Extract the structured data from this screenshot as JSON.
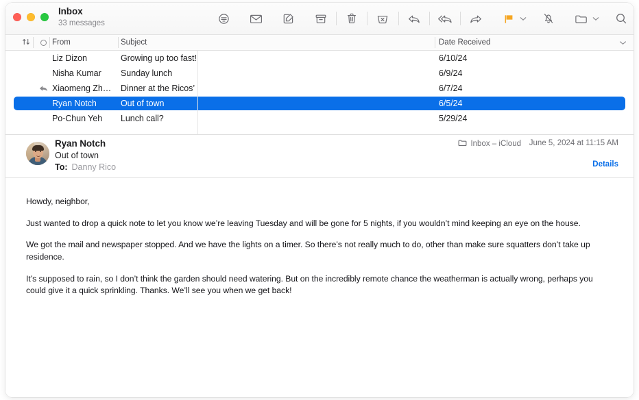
{
  "window": {
    "title": "Inbox",
    "subtitle": "33 messages",
    "traffic_lights": [
      "close",
      "minimize",
      "zoom"
    ]
  },
  "toolbar": {
    "items": [
      {
        "name": "filter-button",
        "icon": "filter-icon",
        "label": "Filter"
      },
      {
        "name": "mark-read-button",
        "icon": "envelope-icon",
        "label": "Mark as Read"
      },
      {
        "name": "compose-button",
        "icon": "compose-icon",
        "label": "New Message"
      },
      {
        "name": "archive-button",
        "icon": "archive-box-icon",
        "label": "Archive"
      },
      {
        "name": "delete-button",
        "icon": "trash-icon",
        "label": "Delete"
      },
      {
        "name": "junk-button",
        "icon": "junk-icon",
        "label": "Move to Junk"
      },
      {
        "name": "reply-button",
        "icon": "reply-arrow-icon",
        "label": "Reply"
      },
      {
        "name": "reply-all-button",
        "icon": "reply-all-icon",
        "label": "Reply All"
      },
      {
        "name": "forward-button",
        "icon": "forward-arrow-icon",
        "label": "Forward"
      },
      {
        "name": "flag-button",
        "icon": "flag-icon",
        "label": "Flag"
      },
      {
        "name": "mute-button",
        "icon": "bell-slash-icon",
        "label": "Mute"
      },
      {
        "name": "move-button",
        "icon": "folder-icon",
        "label": "Move To"
      },
      {
        "name": "search-button",
        "icon": "search-icon",
        "label": "Search"
      }
    ],
    "flag_color": "#f5a623"
  },
  "columns": {
    "sort": "sort-arrows-icon",
    "unread": "unread-circle-icon",
    "from": "From",
    "subject": "Subject",
    "date": "Date Received",
    "sort_chevron": "chevron-down-icon"
  },
  "messages": [
    {
      "flag": "",
      "from": "Liz Dizon",
      "subject": "Growing up too fast!",
      "date": "6/10/24",
      "selected": false
    },
    {
      "flag": "",
      "from": "Nisha Kumar",
      "subject": "Sunday lunch",
      "date": "6/9/24",
      "selected": false
    },
    {
      "flag": "replied",
      "from": "Xiaomeng Zh…",
      "subject": "Dinner at the Ricos’",
      "date": "6/7/24",
      "selected": false
    },
    {
      "flag": "",
      "from": "Ryan Notch",
      "subject": "Out of town",
      "date": "6/5/24",
      "selected": true
    },
    {
      "flag": "",
      "from": "Po-Chun Yeh",
      "subject": "Lunch call?",
      "date": "5/29/24",
      "selected": false
    }
  ],
  "selection_color": "#0a6fe8",
  "message": {
    "sender": "Ryan Notch",
    "subject": "Out of town",
    "to_label": "To:",
    "to_value": "Danny Rico",
    "mailbox": "Inbox – iCloud",
    "mailbox_icon": "folder-icon",
    "date": "June 5, 2024 at 11:15 AM",
    "details_link": "Details",
    "avatar": "contact-photo",
    "body": [
      "Howdy, neighbor,",
      "Just wanted to drop a quick note to let you know we’re leaving Tuesday and will be gone for 5 nights, if you wouldn’t mind keeping an eye on the house.",
      "We got the mail and newspaper stopped. And we have the lights on a timer. So there’s not really much to do, other than make sure squatters don’t take up residence.",
      "It’s supposed to rain, so I don’t think the garden should need watering. But on the incredibly remote chance the weatherman is actually wrong, perhaps you could give it a quick sprinkling. Thanks. We’ll see you when we get back!"
    ]
  }
}
